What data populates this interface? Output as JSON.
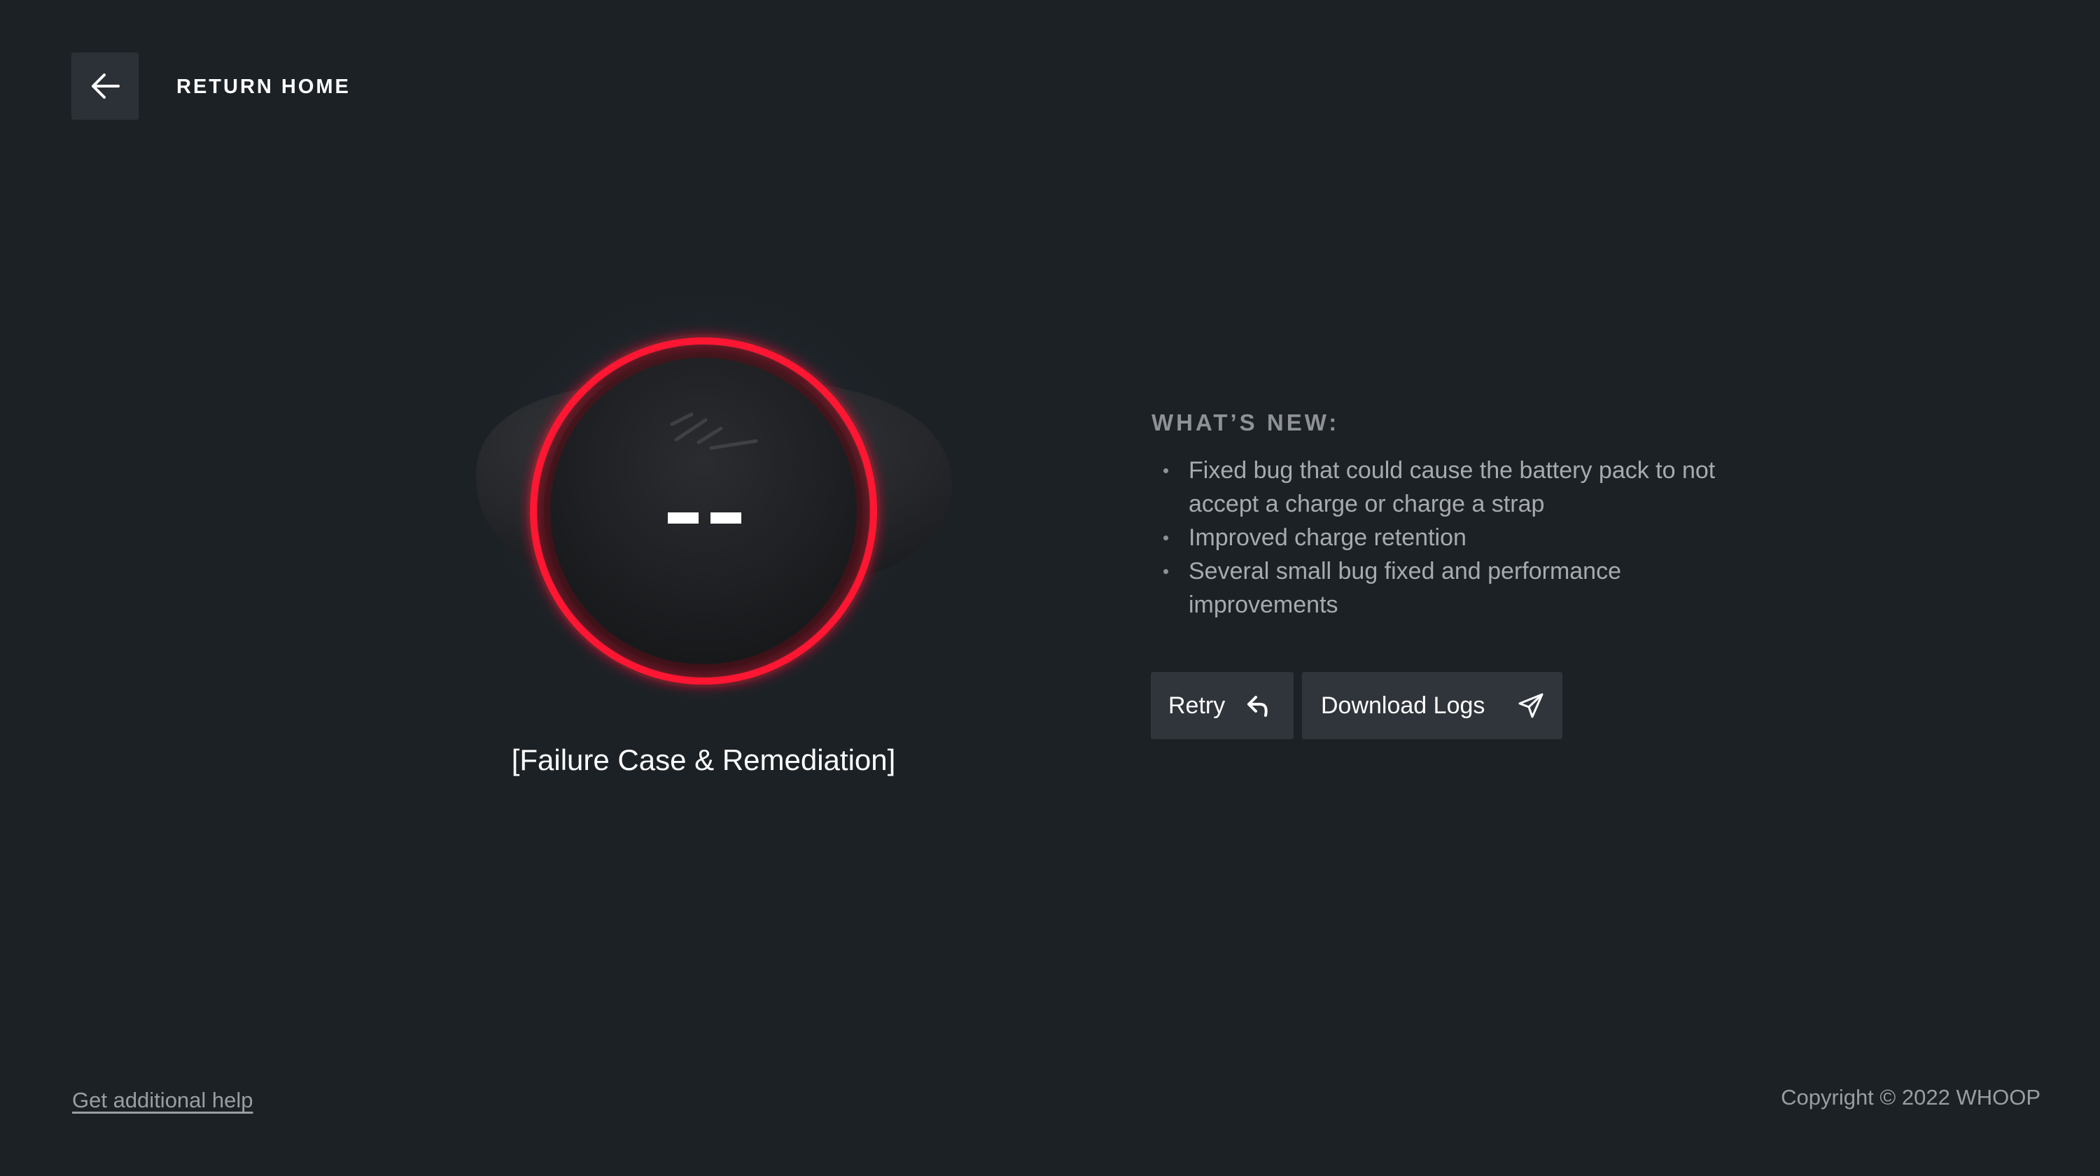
{
  "header": {
    "back_icon": "arrow-left-icon",
    "return_label": "RETURN HOME"
  },
  "device": {
    "status_display": "--",
    "ring_color": "#ff1433",
    "caption": "[Failure Case & Remediation]"
  },
  "whats_new": {
    "title": "WHAT’S NEW:",
    "items": [
      "Fixed bug that could cause the battery pack to not accept a charge or charge a strap",
      "Improved charge retention",
      "Several small bug fixed and performance improvements"
    ]
  },
  "actions": {
    "retry_label": "Retry",
    "retry_icon": "reply-arrow-icon",
    "download_label": "Download Logs",
    "download_icon": "paper-plane-icon"
  },
  "footer": {
    "help_link": "Get additional help",
    "copyright": "Copyright © 2022 WHOOP"
  },
  "colors": {
    "background": "#1c2126",
    "button_bg": "#30353b",
    "accent_red": "#ff1433",
    "muted_text": "#9a9ea2"
  }
}
